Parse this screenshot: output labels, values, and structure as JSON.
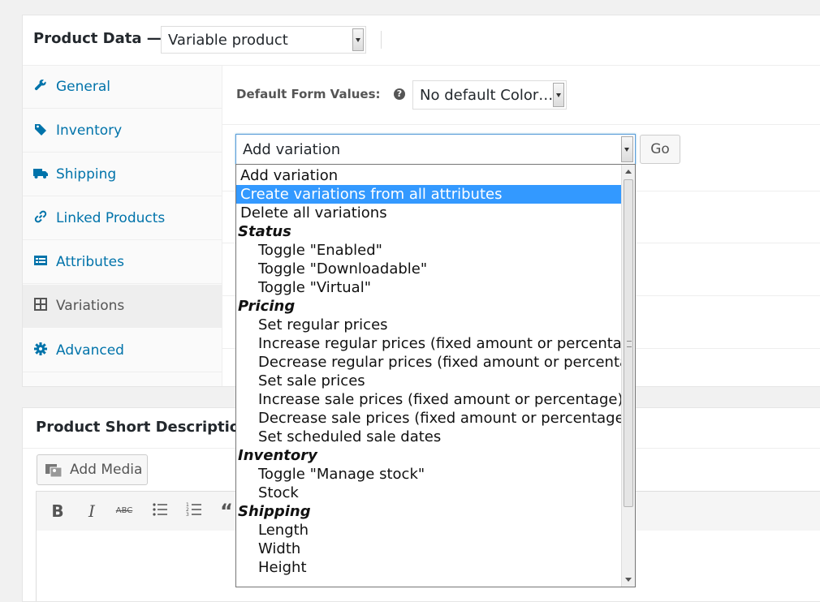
{
  "product_data": {
    "title": "Product Data —",
    "product_type": "Variable product",
    "tabs": [
      {
        "label": "General",
        "icon": "wrench-icon"
      },
      {
        "label": "Inventory",
        "icon": "tag-icon"
      },
      {
        "label": "Shipping",
        "icon": "truck-icon"
      },
      {
        "label": "Linked Products",
        "icon": "link-icon"
      },
      {
        "label": "Attributes",
        "icon": "list-icon"
      },
      {
        "label": "Variations",
        "icon": "grid-icon",
        "active": true
      },
      {
        "label": "Advanced",
        "icon": "gear-icon"
      }
    ],
    "default_form_values_label": "Default Form Values:",
    "default_color_value": "No default Color…",
    "variation_action_value": "Add variation",
    "go_label": "Go"
  },
  "variation_actions": {
    "options": [
      {
        "text": "Add variation",
        "kind": "option"
      },
      {
        "text": "Create variations from all attributes",
        "kind": "option",
        "selected": true
      },
      {
        "text": "Delete all variations",
        "kind": "option"
      },
      {
        "text": "Status",
        "kind": "group"
      },
      {
        "text": "Toggle \"Enabled\"",
        "kind": "sub"
      },
      {
        "text": "Toggle \"Downloadable\"",
        "kind": "sub"
      },
      {
        "text": "Toggle \"Virtual\"",
        "kind": "sub"
      },
      {
        "text": "Pricing",
        "kind": "group"
      },
      {
        "text": "Set regular prices",
        "kind": "sub"
      },
      {
        "text": "Increase regular prices (fixed amount or percentage)",
        "kind": "sub"
      },
      {
        "text": "Decrease regular prices (fixed amount or percentage)",
        "kind": "sub"
      },
      {
        "text": "Set sale prices",
        "kind": "sub"
      },
      {
        "text": "Increase sale prices (fixed amount or percentage)",
        "kind": "sub"
      },
      {
        "text": "Decrease sale prices (fixed amount or percentage)",
        "kind": "sub"
      },
      {
        "text": "Set scheduled sale dates",
        "kind": "sub"
      },
      {
        "text": "Inventory",
        "kind": "group"
      },
      {
        "text": "Toggle \"Manage stock\"",
        "kind": "sub"
      },
      {
        "text": "Stock",
        "kind": "sub"
      },
      {
        "text": "Shipping",
        "kind": "group"
      },
      {
        "text": "Length",
        "kind": "sub"
      },
      {
        "text": "Width",
        "kind": "sub"
      },
      {
        "text": "Height",
        "kind": "sub"
      }
    ]
  },
  "short_description": {
    "title": "Product Short Description",
    "add_media_label": "Add Media",
    "toolbar": [
      "bold-icon",
      "italic-icon",
      "strikethrough-icon",
      "bullet-list-icon",
      "numbered-list-icon",
      "blockquote-icon"
    ]
  },
  "colors": {
    "accent": "#0073aa",
    "selected_option": "#3399ff",
    "focus_border": "#5b9dd9"
  }
}
